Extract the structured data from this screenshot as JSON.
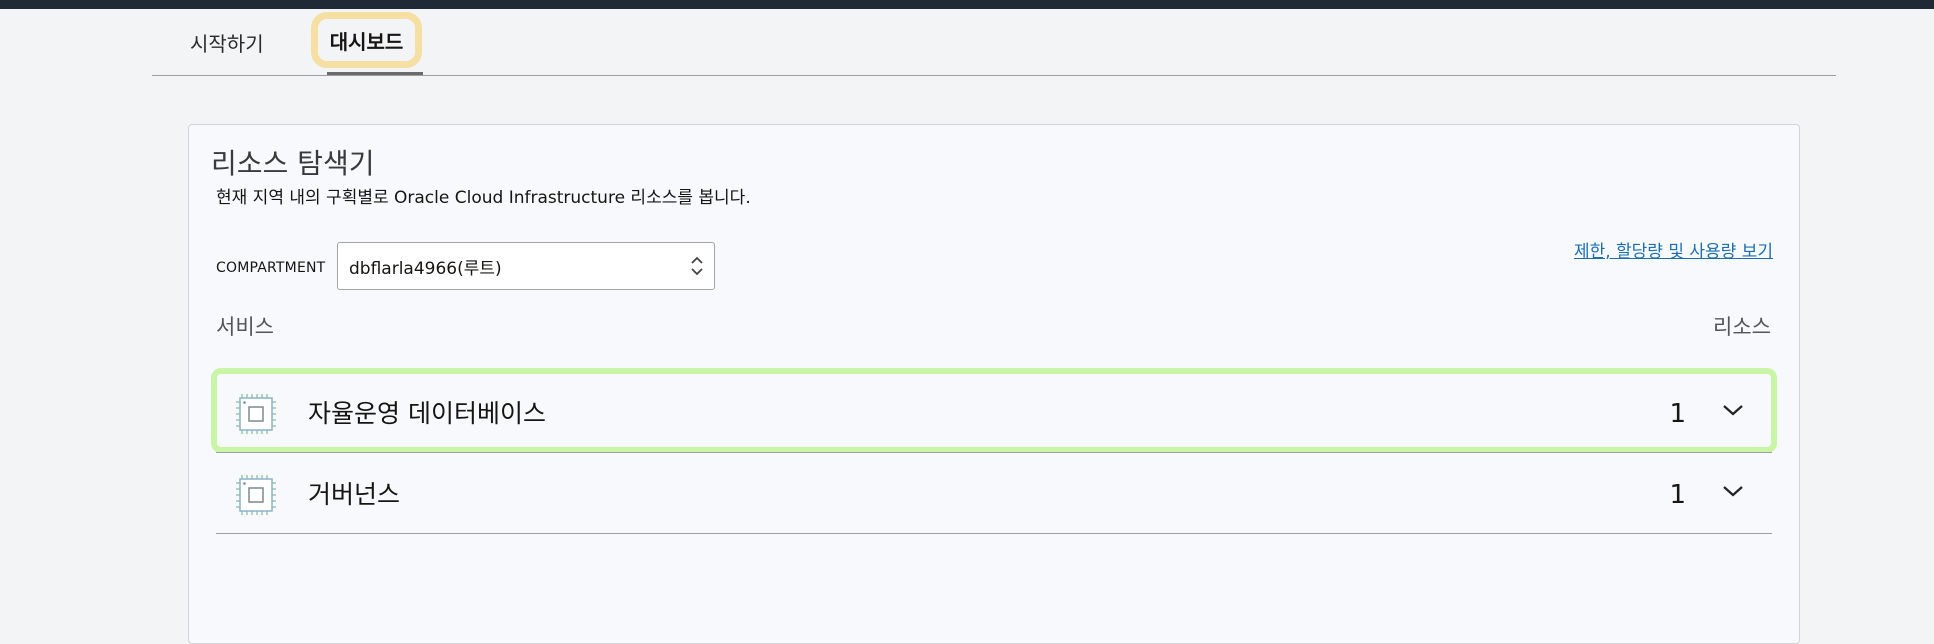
{
  "tabs": {
    "start_label": "시작하기",
    "dashboard_label": "대시보드"
  },
  "explorer": {
    "title": "리소스 탐색기",
    "subtitle": "현재 지역 내의 구획별로 Oracle Cloud Infrastructure 리소스를 봅니다.",
    "limits_link": "제한, 할당량 및 사용량 보기",
    "compartment_label": "COMPARTMENT",
    "compartment_value": "dbflarla4966(루트)",
    "col_service": "서비스",
    "col_resources": "리소스",
    "services": [
      {
        "name": "자율운영 데이터베이스",
        "count": "1",
        "icon": "chip-icon"
      },
      {
        "name": "거버넌스",
        "count": "1",
        "icon": "chip-icon"
      }
    ]
  },
  "colors": {
    "link": "#1c6eb3",
    "tab_highlight": "#f6dfa3",
    "row_highlight": "#c9f5a6",
    "topbar": "#1f2a36"
  }
}
